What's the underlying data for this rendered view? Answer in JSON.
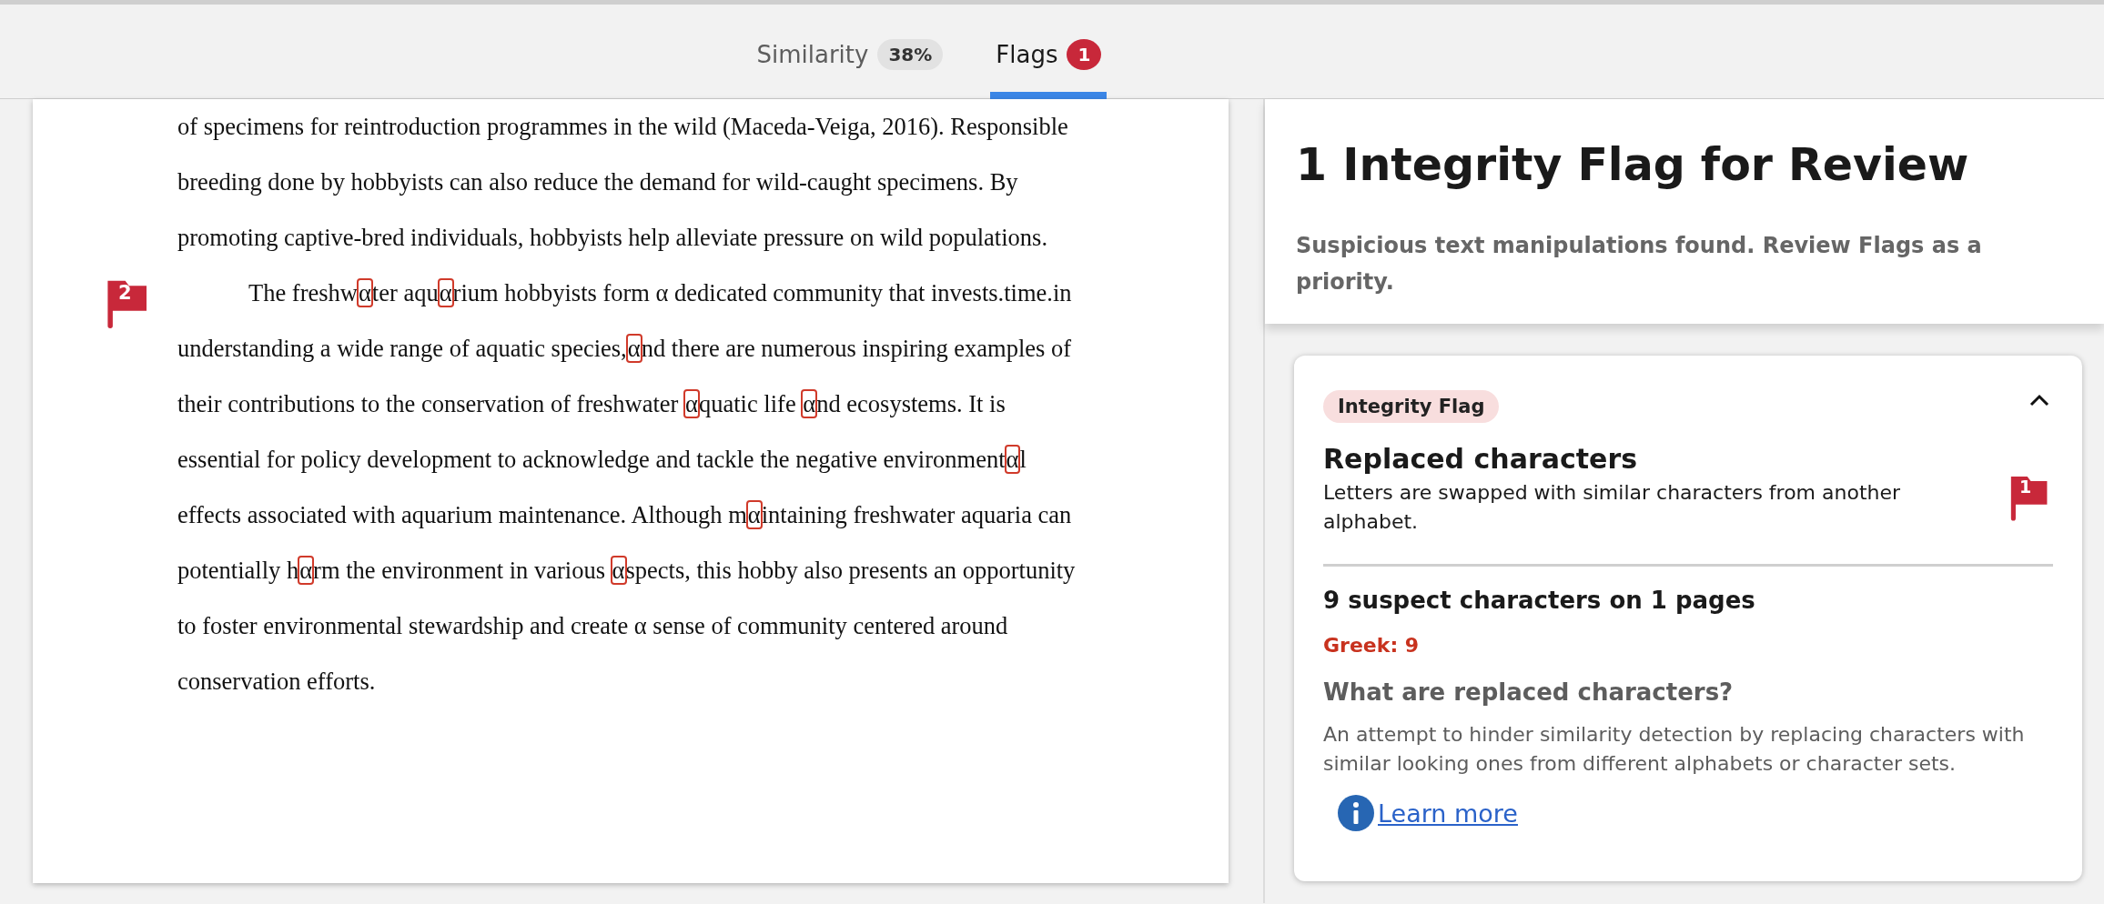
{
  "tabs": [
    {
      "label": "Similarity",
      "badge": "38%",
      "color": "#e2e2e2",
      "selected": false
    },
    {
      "label": "Flags",
      "badge": "1",
      "color": "#c8283a",
      "selected": true
    }
  ],
  "document": {
    "paragraphs": [
      {
        "indented": false,
        "lines": [
          [
            {
              "text": "of specimens for reintroduction programmes in the wild (Maceda-Veiga, 2016). Responsible",
              "flagged": false
            }
          ],
          [
            {
              "text": "breeding done by hobbyists can also reduce the demand for wild-caught specimens. By",
              "flagged": false
            }
          ],
          [
            {
              "text": "promoting captive-bred individuals, hobbyists help alleviate pressure on wild populations.",
              "flagged": false
            }
          ]
        ]
      },
      {
        "indented": true,
        "flag": "2",
        "lines": [
          [
            {
              "text": "The freshw",
              "flagged": false
            },
            {
              "text": "α",
              "flagged": true
            },
            {
              "text": "ter aqu",
              "flagged": false
            },
            {
              "text": "α",
              "flagged": true
            },
            {
              "text": "rium hobbyists form α dedicated community that invests.time.in",
              "flagged": false
            }
          ],
          [
            {
              "text": "understanding a wide range of aquatic species,",
              "flagged": false
            },
            {
              "text": "α",
              "flagged": true
            },
            {
              "text": "nd there are numerous inspiring examples of",
              "flagged": false
            }
          ],
          [
            {
              "text": "their contributions to the conservation of freshwater ",
              "flagged": false
            },
            {
              "text": "α",
              "flagged": true
            },
            {
              "text": "quatic life ",
              "flagged": false
            },
            {
              "text": "α",
              "flagged": true
            },
            {
              "text": "nd ecosystems. It is",
              "flagged": false
            }
          ],
          [
            {
              "text": "essential for policy development to acknowledge and tackle the negative environment",
              "flagged": false
            },
            {
              "text": "α",
              "flagged": true
            },
            {
              "text": "l",
              "flagged": false
            }
          ],
          [
            {
              "text": "effects associated with aquarium maintenance. Although m",
              "flagged": false
            },
            {
              "text": "α",
              "flagged": true
            },
            {
              "text": "intaining freshwater aquaria can",
              "flagged": false
            }
          ],
          [
            {
              "text": "potentially h",
              "flagged": false
            },
            {
              "text": "α",
              "flagged": true
            },
            {
              "text": "rm the environment in various ",
              "flagged": false
            },
            {
              "text": "α",
              "flagged": true
            },
            {
              "text": "spects, this hobby also presents an opportunity",
              "flagged": false
            }
          ],
          [
            {
              "text": "to foster environmental stewardship and create α sense of community centered around",
              "flagged": false
            }
          ],
          [
            {
              "text": "conservation efforts.",
              "flagged": false
            }
          ]
        ]
      }
    ]
  },
  "summary": {
    "title": "1 Integrity Flag for Review",
    "subtitle": "Suspicious text manipulations found. Review Flags as a priority."
  },
  "flag_card": {
    "tag": "Integrity Flag",
    "expanded": true,
    "title": "Replaced characters",
    "description": "Letters are swapped with similar characters from another alphabet.",
    "flag_number": "1",
    "count_line": "9 suspect characters on 1 pages",
    "breakdown": [
      "Greek: 9"
    ],
    "question": "What are replaced characters?",
    "answer": "An attempt to hinder similarity detection by replacing characters with similar looking ones from different alphabets or character sets.",
    "link": "Learn more"
  }
}
